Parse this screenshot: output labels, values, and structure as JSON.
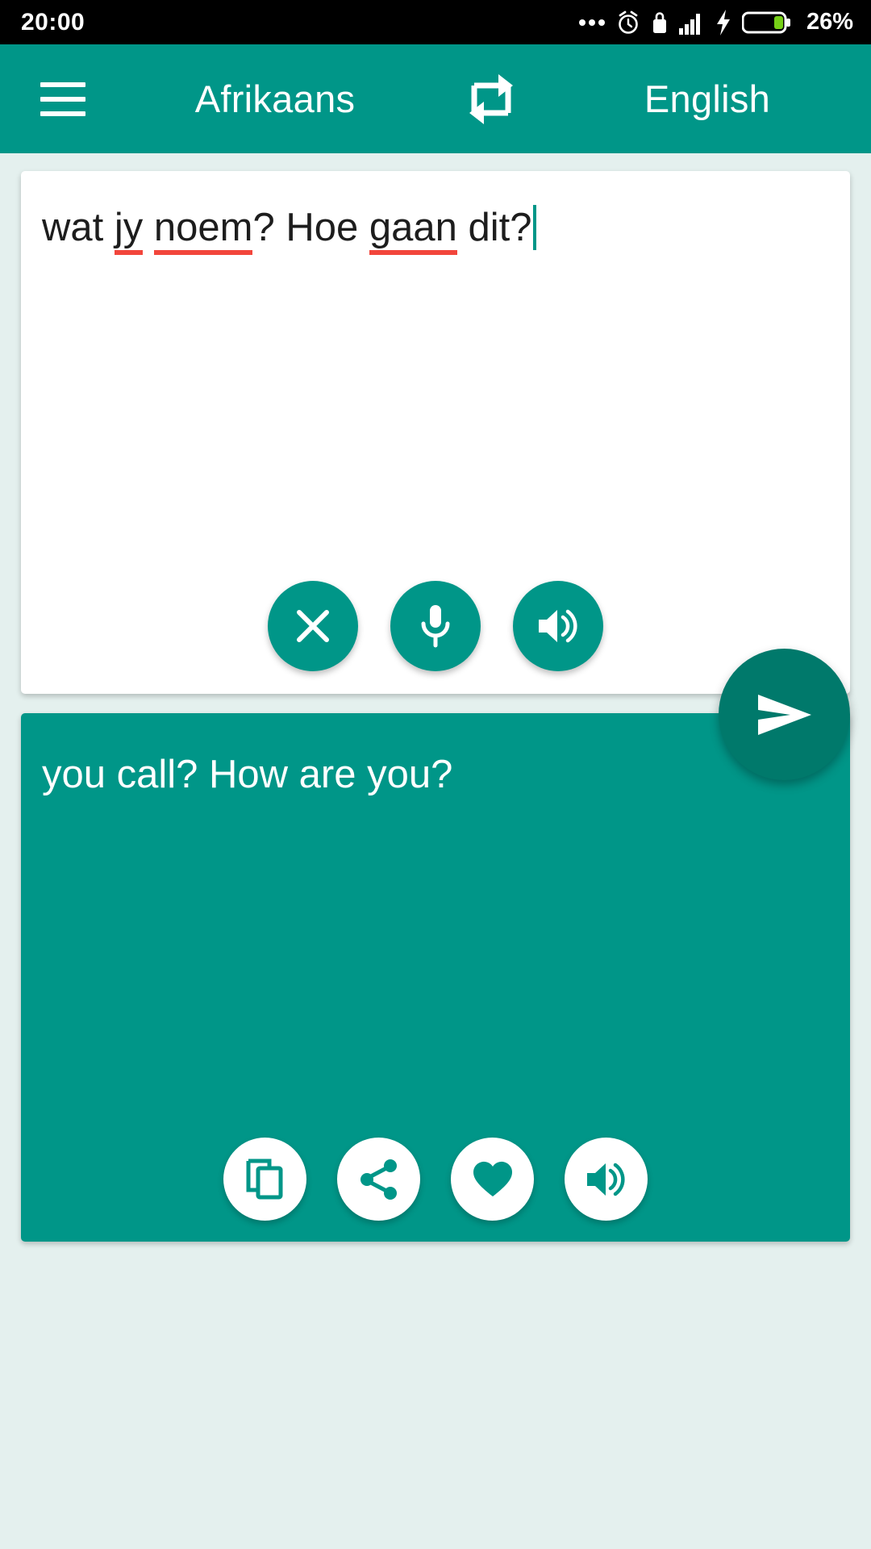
{
  "status_bar": {
    "time": "20:00",
    "battery_percent": "26%",
    "icons": [
      "more-dots-icon",
      "alarm-clock-icon",
      "lock-icon",
      "signal-bars-icon",
      "charging-bolt-icon",
      "battery-icon"
    ]
  },
  "app_bar": {
    "menu_label": "menu-icon",
    "source_language": "Afrikaans",
    "swap_label": "swap-languages-icon",
    "target_language": "English"
  },
  "source_panel": {
    "text_before": "wat ",
    "word_jy": "jy",
    "text_mid1": " ",
    "word_noem": "noem",
    "text_mid2": "? Hoe ",
    "word_gaan": "gaan",
    "text_after": " dit?",
    "full_text": "wat jy noem? Hoe gaan dit?",
    "misspelled_words": [
      "jy",
      "noem",
      "gaan"
    ],
    "actions": [
      {
        "name": "clear-button",
        "icon": "close-icon"
      },
      {
        "name": "microphone-button",
        "icon": "microphone-icon"
      },
      {
        "name": "speak-source-button",
        "icon": "speaker-icon"
      }
    ]
  },
  "send_button": {
    "name": "send-button",
    "icon": "send-icon"
  },
  "target_panel": {
    "text": "you call? How are you?",
    "actions": [
      {
        "name": "copy-button",
        "icon": "copy-icon"
      },
      {
        "name": "share-button",
        "icon": "share-icon"
      },
      {
        "name": "favorite-button",
        "icon": "heart-icon"
      },
      {
        "name": "speak-target-button",
        "icon": "speaker-icon"
      }
    ]
  },
  "colors": {
    "primary": "#009688",
    "primary_dark": "#00796b",
    "background": "#e4f0ee",
    "status_bar": "#000000",
    "spellcheck_underline": "#f2463c",
    "card_white": "#ffffff",
    "battery_fill": "#76d017"
  }
}
